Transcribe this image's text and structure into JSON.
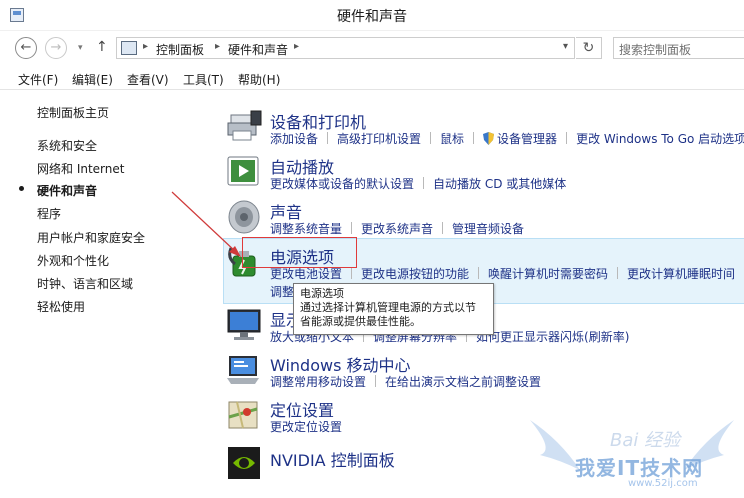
{
  "window": {
    "title": "硬件和声音"
  },
  "address": {
    "crumbs": [
      "控制面板",
      "硬件和声音"
    ],
    "search_placeholder": "搜索控制面板"
  },
  "menu": [
    "文件(F)",
    "编辑(E)",
    "查看(V)",
    "工具(T)",
    "帮助(H)"
  ],
  "sidebar": {
    "items": [
      {
        "label": "控制面板主页"
      },
      {
        "label": "系统和安全"
      },
      {
        "label": "网络和 Internet"
      },
      {
        "label": "硬件和声音",
        "active": true
      },
      {
        "label": "程序"
      },
      {
        "label": "用户帐户和家庭安全"
      },
      {
        "label": "外观和个性化"
      },
      {
        "label": "时钟、语言和区域"
      },
      {
        "label": "轻松使用"
      }
    ]
  },
  "sections": [
    {
      "title": "设备和打印机",
      "icon": "printer-icon",
      "links": [
        "添加设备",
        "高级打印机设置",
        "鼠标",
        "设备管理器",
        "更改 Windows To Go 启动选项"
      ]
    },
    {
      "title": "自动播放",
      "icon": "autoplay-icon",
      "links": [
        "更改媒体或设备的默认设置",
        "自动播放 CD 或其他媒体"
      ]
    },
    {
      "title": "声音",
      "icon": "speaker-icon",
      "links": [
        "调整系统音量",
        "更改系统声音",
        "管理音频设备"
      ]
    },
    {
      "title": "电源选项",
      "icon": "power-options-icon",
      "links": [
        "更改电池设置",
        "更改电源按钮的功能",
        "唤醒计算机时需要密码",
        "更改计算机睡眠时间"
      ],
      "links_row2": [
        "调整"
      ]
    },
    {
      "title": "显示",
      "icon": "display-icon",
      "links": [
        "放大或缩小文本",
        "调整屏幕分辨率",
        "如何更正显示器闪烁(刷新率)"
      ]
    },
    {
      "title": "Windows 移动中心",
      "icon": "mobility-center-icon",
      "links": [
        "调整常用移动设置",
        "在给出演示文档之前调整设置"
      ]
    },
    {
      "title": "定位设置",
      "icon": "location-icon",
      "links": [
        "更改定位设置"
      ]
    },
    {
      "title": "NVIDIA 控制面板",
      "icon": "nvidia-icon",
      "links": []
    }
  ],
  "tooltip": {
    "line1": "电源选项",
    "line2": "通过选择计算机管理电源的方式以节",
    "line3": "省能源或提供最佳性能。"
  },
  "watermark": {
    "brand": "我爱IT技术网",
    "site": "www.52ij.com",
    "baidu": "Bai 经验"
  },
  "colors": {
    "link": "#1e3287",
    "highlight": "#e5f3fb",
    "annotation": "#e03a3a"
  }
}
